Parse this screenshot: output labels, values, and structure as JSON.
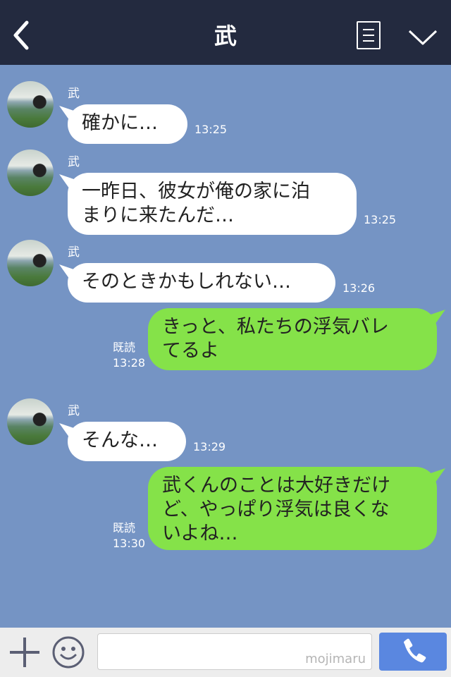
{
  "header": {
    "title": "武",
    "back_icon": "chevron-left-icon",
    "menu_icon": "list-icon",
    "collapse_icon": "chevron-down-icon"
  },
  "messages": [
    {
      "sender": "武",
      "text": "確かに…",
      "time": "13:25"
    },
    {
      "sender": "武",
      "text": "一昨日、彼女が俺の家に泊\nまりに来たんだ…",
      "time": "13:25"
    },
    {
      "sender": "武",
      "text": "そのときかもしれない…",
      "time": "13:26"
    },
    {
      "text": "きっと、私たちの浮気バレ\nてるよ",
      "read": "既読",
      "time": "13:28"
    },
    {
      "sender": "武",
      "text": "そんな…",
      "time": "13:29"
    },
    {
      "text": "武くんのことは大好きだけ\nど、やっぱり浮気は良くな\nいよね…",
      "read": "既読",
      "time": "13:30"
    }
  ],
  "input_bar": {
    "placeholder": "",
    "watermark": "mojimaru",
    "add_icon": "plus-icon",
    "emoji_icon": "smiley-icon",
    "call_icon": "phone-icon"
  },
  "colors": {
    "header": "#232a3f",
    "background": "#7594c4",
    "incoming_bubble": "#ffffff",
    "outgoing_bubble": "#85e249",
    "call_button": "#5a87e0"
  }
}
